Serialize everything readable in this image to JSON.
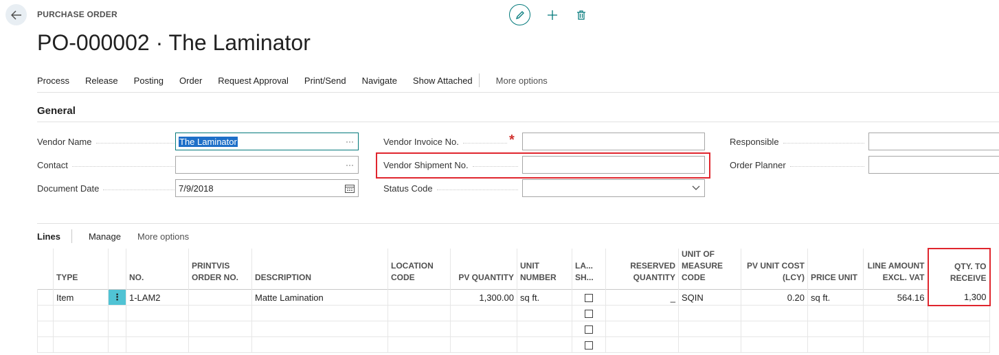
{
  "header": {
    "caption": "PURCHASE ORDER",
    "title": "PO-000002 · The Laminator"
  },
  "actions": [
    "Process",
    "Release",
    "Posting",
    "Order",
    "Request Approval",
    "Print/Send",
    "Navigate",
    "Show Attached"
  ],
  "more_options": "More options",
  "general": {
    "title": "General",
    "vendor_name_label": "Vendor Name",
    "vendor_name_value": "The Laminator",
    "contact_label": "Contact",
    "contact_value": "",
    "document_date_label": "Document Date",
    "document_date_value": "7/9/2018",
    "vendor_invoice_label": "Vendor Invoice No.",
    "vendor_invoice_value": "",
    "vendor_shipment_label": "Vendor Shipment No.",
    "vendor_shipment_value": "",
    "status_code_label": "Status Code",
    "status_code_value": "",
    "responsible_label": "Responsible",
    "responsible_value": "",
    "order_planner_label": "Order Planner",
    "order_planner_value": "",
    "required_marker": "*",
    "ellipsis": "···"
  },
  "lines": {
    "title": "Lines",
    "manage": "Manage",
    "more_options": "More options",
    "columns": [
      {
        "label": "TYPE"
      },
      {
        "label": ""
      },
      {
        "label": "NO."
      },
      {
        "label": "PRINTVIS ORDER NO."
      },
      {
        "label": "DESCRIPTION"
      },
      {
        "label": "LOCATION CODE"
      },
      {
        "label": "PV QUANTITY"
      },
      {
        "label": "UNIT NUMBER"
      },
      {
        "label": "LA... SH..."
      },
      {
        "label": "RESERVED QUANTITY"
      },
      {
        "label": "UNIT OF MEASURE CODE"
      },
      {
        "label": "PV UNIT COST (LCY)"
      },
      {
        "label": "PRICE UNIT"
      },
      {
        "label": "LINE AMOUNT EXCL. VAT"
      },
      {
        "label": "QTY. TO RECEIVE"
      }
    ],
    "row": {
      "type": "Item",
      "menu": "⋮",
      "no": "1-LAM2",
      "printvis_order_no": "",
      "description": "Matte Lamination",
      "location_code": "",
      "pv_quantity": "1,300.00",
      "unit_number": "sq ft.",
      "reserved_quantity": "_",
      "uom_code": "SQIN",
      "pv_unit_cost": "0.20",
      "price_unit": "sq ft.",
      "line_amount": "564.16",
      "qty_to_receive": "1,300"
    }
  }
}
